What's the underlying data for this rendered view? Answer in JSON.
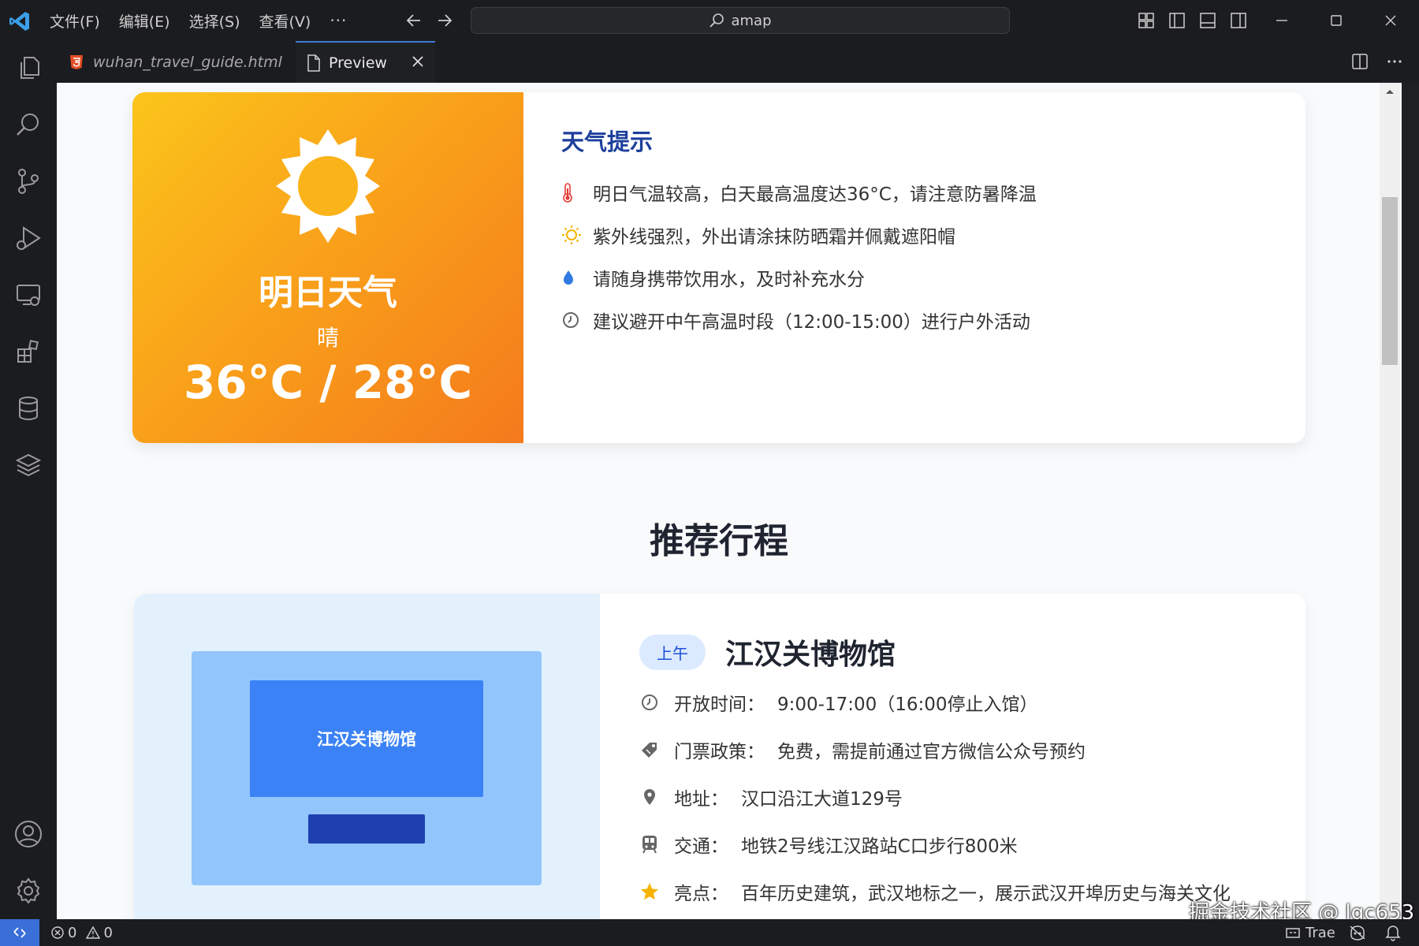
{
  "titlebar": {
    "menus": [
      "文件(F)",
      "编辑(E)",
      "选择(S)",
      "查看(V)"
    ],
    "more": "···",
    "search": "amap"
  },
  "tabs": [
    {
      "label": "wuhan_travel_guide.html",
      "icon": "html5-icon",
      "active": false
    },
    {
      "label": "Preview",
      "icon": "file-icon",
      "active": true
    }
  ],
  "weather": {
    "title": "明日天气",
    "condition": "晴",
    "temperature": "36°C / 28°C",
    "tips_title": "天气提示",
    "tips": [
      {
        "icon": "thermometer-icon",
        "text": "明日气温较高，白天最高温度达36°C，请注意防暑降温"
      },
      {
        "icon": "sun-icon",
        "text": "紫外线强烈，外出请涂抹防晒霜并佩戴遮阳帽"
      },
      {
        "icon": "water-drop-icon",
        "text": "请随身携带饮用水，及时补充水分"
      },
      {
        "icon": "clock-icon",
        "text": "建议避开中午高温时段（12:00-15:00）进行户外活动"
      }
    ]
  },
  "section": {
    "title": "推荐行程"
  },
  "itinerary": {
    "badge": "上午",
    "title": "江汉关博物馆",
    "image_label": "江汉关博物馆",
    "rows": [
      {
        "icon": "clock-icon",
        "label": "开放时间：",
        "value": "9:00-17:00（16:00停止入馆）"
      },
      {
        "icon": "ticket-icon",
        "label": "门票政策：",
        "value": "免费，需提前通过官方微信公众号预约"
      },
      {
        "icon": "map-pin-icon",
        "label": "地址：",
        "value": "汉口沿江大道129号"
      },
      {
        "icon": "train-icon",
        "label": "交通：",
        "value": "地铁2号线江汉路站C口步行800米"
      },
      {
        "icon": "star-icon",
        "label": "亮点：",
        "value": "百年历史建筑，武汉地标之一，展示武汉开埠历史与海关文化"
      }
    ]
  },
  "watermark": "掘金技术社区 @ lgc653",
  "statusbar": {
    "errors": "0",
    "warnings": "0",
    "app": "Trae"
  },
  "colors": {
    "accent": "#3a6fd8",
    "weather_gradient_start": "#fbc51b",
    "weather_gradient_end": "#f57a1c",
    "tips_title": "#1d3f9c",
    "badge_bg": "#dbeafe",
    "image_bg": "#e3f1fd"
  }
}
